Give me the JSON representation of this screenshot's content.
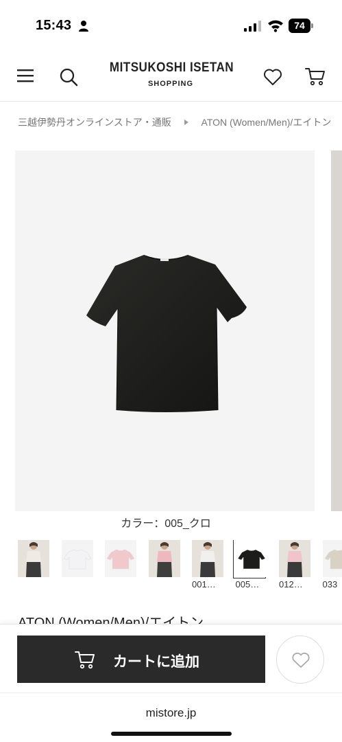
{
  "status_bar": {
    "time": "15:43",
    "battery": "74"
  },
  "header": {
    "logo_main": "MITSUKOSHI ISETAN",
    "logo_sub": "SHOPPING"
  },
  "breadcrumb": [
    "三越伊勢丹オンラインストア・通販",
    "ATON (Women/Men)/エイトン"
  ],
  "product": {
    "color_label": "カラー：005_クロ",
    "title": "ATON (Women/Men)/エイトン",
    "thumbnails": [
      {
        "code": "",
        "kind": "model",
        "top": "#efeae6",
        "pants": "#3a3a3a"
      },
      {
        "code": "",
        "kind": "flat",
        "shirt": "#f3f3f5"
      },
      {
        "code": "",
        "kind": "flat",
        "shirt": "#f1c9cc"
      },
      {
        "code": "",
        "kind": "model",
        "top": "#eeb8be",
        "pants": "#3e3e3e"
      },
      {
        "code": "001…",
        "kind": "model",
        "top": "#f2f0ee",
        "pants": "#3a3a3a"
      },
      {
        "code": "005…",
        "kind": "flat",
        "shirt": "#1c1c1a",
        "selected": true
      },
      {
        "code": "012…",
        "kind": "model",
        "top": "#f0c4c8",
        "pants": "#3a3a3a"
      },
      {
        "code": "033",
        "kind": "flat",
        "shirt": "#d9d2c4"
      }
    ]
  },
  "actions": {
    "add_to_cart": "カートに追加"
  },
  "browser": {
    "domain": "mistore.jp"
  }
}
